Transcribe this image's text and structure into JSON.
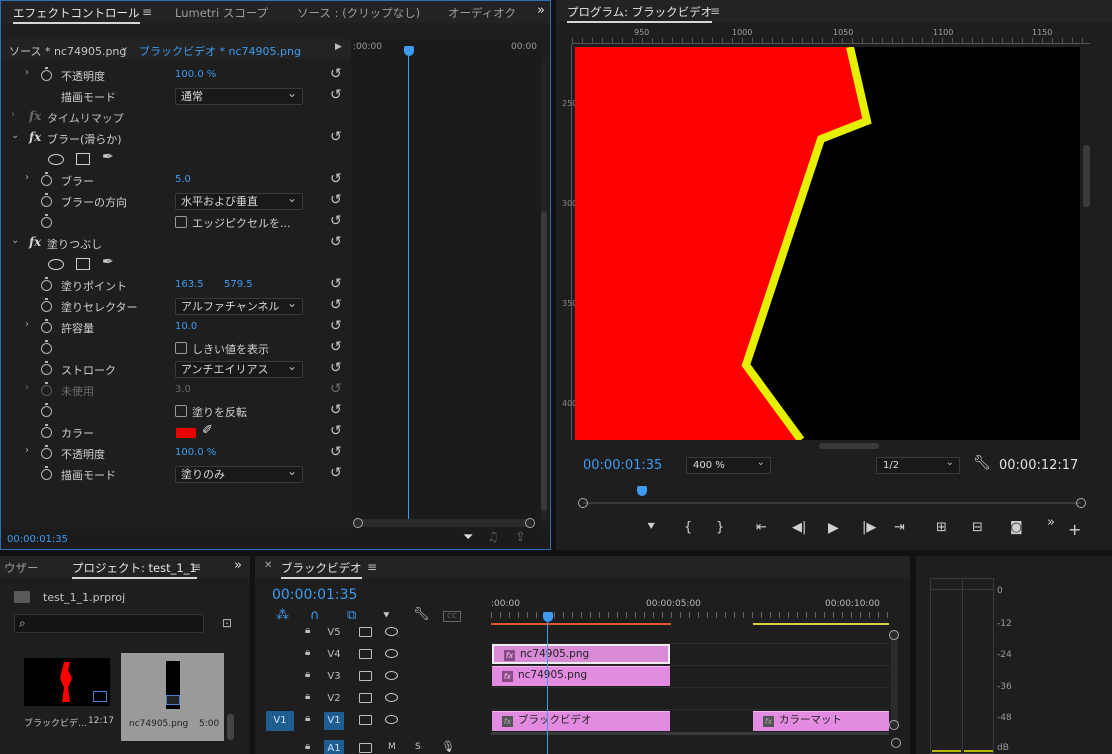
{
  "effect_controls": {
    "tabs": [
      "エフェクトコントロール",
      "Lumetri スコープ",
      "ソース : (クリップなし)",
      "オーディオク"
    ],
    "source_label": "ソース * nc74905.png",
    "sequence_label": "ブラックビデオ * nc74905.png",
    "time_start": ":00:00",
    "time_end": "00:00",
    "current_time": "00:00:01:35",
    "rows": [
      {
        "label": "不透明度",
        "value": "100.0 %"
      },
      {
        "label": "描画モード",
        "value": "通常"
      },
      {
        "label": "タイムリマップ"
      },
      {
        "label": "ブラー(滑らか)"
      },
      {
        "label": "ブラー",
        "value": "5.0"
      },
      {
        "label": "ブラーの方向",
        "value": "水平および垂直"
      },
      {
        "checkbox": "エッジピクセルを..."
      },
      {
        "label": "塗りつぶし"
      },
      {
        "label": "塗りポイント",
        "value": "163.5",
        "value2": "579.5"
      },
      {
        "label": "塗りセレクター",
        "value": "アルファチャンネル"
      },
      {
        "label": "許容量",
        "value": "10.0"
      },
      {
        "checkbox": "しきい値を表示"
      },
      {
        "label": "ストローク",
        "value": "アンチエイリアス"
      },
      {
        "label": "未使用",
        "value": "3.0"
      },
      {
        "checkbox": "塗りを反転"
      },
      {
        "label": "カラー",
        "color": "#e60000"
      },
      {
        "label": "不透明度",
        "value": "100.0 %"
      },
      {
        "label": "描画モード",
        "value": "塗りのみ"
      }
    ]
  },
  "program": {
    "title": "プログラム: ブラックビデオ",
    "ruler": [
      "950",
      "1000",
      "1050",
      "1100",
      "1150"
    ],
    "vruler": [
      "250",
      "300",
      "350",
      "400"
    ],
    "timecode": "00:00:01:35",
    "zoom": "400 %",
    "resolution": "1/2",
    "duration": "00:00:12:17",
    "fill_color": "#ff0000",
    "stroke_color": "#e5f000"
  },
  "project": {
    "tabs": [
      "ウザー",
      "プロジェクト: test_1_1"
    ],
    "file": "test_1_1.prproj",
    "items": [
      {
        "name": "ブラックビデ...",
        "duration": "12:17"
      },
      {
        "name": "nc74905.png",
        "duration": "5:00"
      }
    ]
  },
  "timeline": {
    "title": "ブラックビデオ",
    "timecode": "00:00:01:35",
    "ruler": [
      ":00:00",
      "00:00:05:00",
      "00:00:10:00"
    ],
    "tracks": [
      {
        "name": "V5"
      },
      {
        "name": "V4"
      },
      {
        "name": "V3"
      },
      {
        "name": "V2"
      },
      {
        "name": "V1",
        "source": "V1"
      },
      {
        "name": "A1",
        "m": "M",
        "s": "S"
      }
    ],
    "clips": {
      "v4": "nc74905.png",
      "v3": "nc74905.png",
      "v1a": "ブラックビデオ",
      "v1b": "カラーマット"
    }
  },
  "audio_meter": {
    "labels": [
      "0",
      "-12",
      "-24",
      "-36",
      "-48",
      "dB"
    ]
  }
}
